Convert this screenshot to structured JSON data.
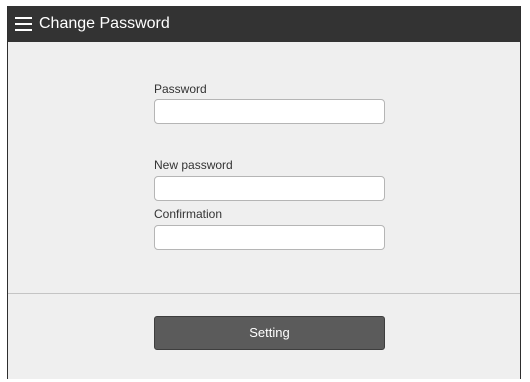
{
  "header": {
    "title": "Change Password",
    "background": "#333333",
    "menu_icon": "hamburger-menu-icon"
  },
  "form": {
    "password_label": "Password",
    "password_value": "",
    "new_password_label": "New password",
    "new_password_value": "",
    "confirmation_label": "Confirmation",
    "confirmation_value": ""
  },
  "footer": {
    "setting_label": "Setting",
    "button_color": "#5b5b5b"
  }
}
